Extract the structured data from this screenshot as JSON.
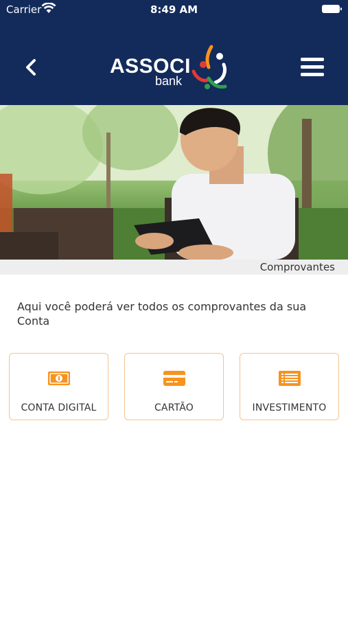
{
  "status_bar": {
    "carrier": "Carrier",
    "time": "8:49 AM"
  },
  "header": {
    "logo_text": "ASSOCI",
    "logo_subtext": "bank",
    "background_color": "#132b5b"
  },
  "hero": {
    "caption": "Comprovantes"
  },
  "main": {
    "description": "Aqui você poderá ver todos os comprovantes da sua Conta",
    "options": [
      {
        "label": "CONTA DIGITAL",
        "icon": "money-bill-icon"
      },
      {
        "label": "CARTÃO",
        "icon": "credit-card-icon"
      },
      {
        "label": "INVESTIMENTO",
        "icon": "list-document-icon"
      }
    ],
    "accent_color": "#f7931e"
  }
}
